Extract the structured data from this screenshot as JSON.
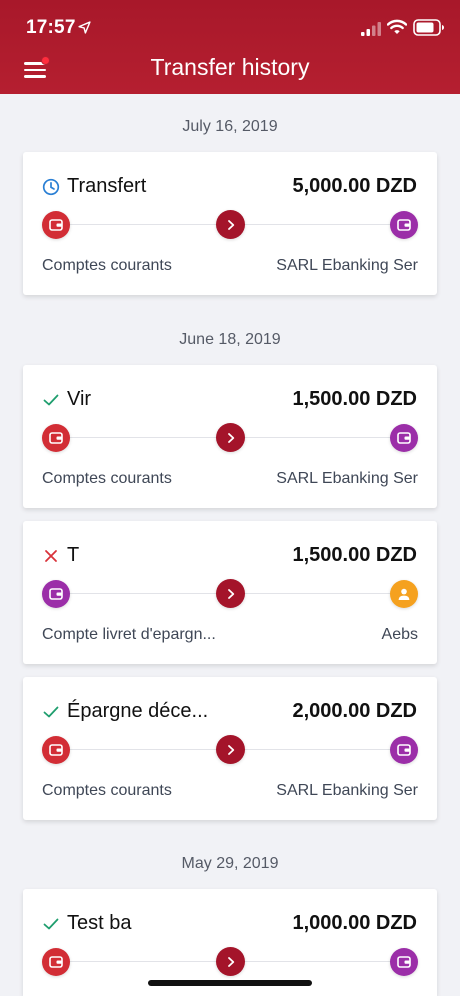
{
  "status_bar": {
    "time": "17:57"
  },
  "header": {
    "title": "Transfer history"
  },
  "groups": [
    {
      "date": "July 16, 2019"
    },
    {
      "date": "June 18, 2019"
    },
    {
      "date": "May 29, 2019"
    }
  ],
  "transfers": [
    {
      "status": "pending",
      "title": "Transfert",
      "amount": "5,000.00 DZD",
      "from": "Comptes courants",
      "to": "SARL Ebanking Ser",
      "from_icon": "wallet-icon",
      "to_icon": "wallet-icon"
    },
    {
      "status": "success",
      "title": "Vir",
      "amount": "1,500.00 DZD",
      "from": "Comptes courants",
      "to": "SARL Ebanking Ser",
      "from_icon": "wallet-icon",
      "to_icon": "wallet-icon"
    },
    {
      "status": "failed",
      "title": "T",
      "amount": "1,500.00 DZD",
      "from": "Compte livret d'epargn...",
      "to": "Aebs",
      "from_icon": "wallet-icon",
      "to_icon": "person-icon"
    },
    {
      "status": "success",
      "title": "Épargne déce...",
      "amount": "2,000.00 DZD",
      "from": "Comptes courants",
      "to": "SARL Ebanking Ser",
      "from_icon": "wallet-icon",
      "to_icon": "wallet-icon"
    },
    {
      "status": "success",
      "title": "Test ba",
      "amount": "1,000.00 DZD",
      "from": "",
      "to": "",
      "from_icon": "wallet-icon",
      "to_icon": "wallet-icon"
    }
  ],
  "colors": {
    "brand": "#b51f30",
    "source_account": "#d22d35",
    "destination_account": "#9b2ea8",
    "person": "#f5a11f",
    "success": "#1f9e6e",
    "failed": "#d9323a",
    "pending": "#2a7fd4"
  }
}
